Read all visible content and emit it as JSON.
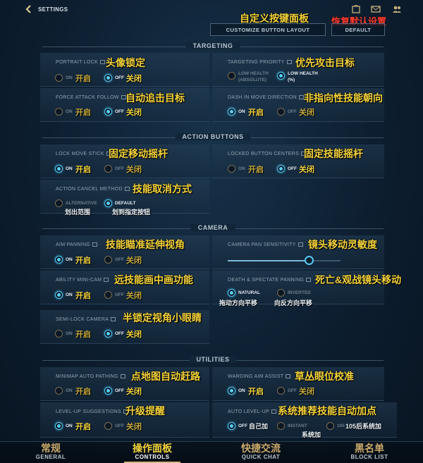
{
  "header": {
    "title": "SETTINGS",
    "annotation_custom_panel": "自定义按键面板",
    "annotation_restore_default": "恢复默认设置",
    "customize_button": "CUSTOMIZE BUTTON LAYOUT",
    "default_button": "DEFAULT",
    "icons": [
      "back-chevron-icon",
      "shop-icon",
      "mail-icon",
      "friends-icon"
    ]
  },
  "sections": {
    "targeting": "TARGETING",
    "action_buttons": "ACTION BUTTONS",
    "camera": "CAMERA",
    "utilities": "UTILITIES"
  },
  "common": {
    "on": "ON",
    "off": "OFF",
    "on_cn": "开启",
    "off_cn": "关闭"
  },
  "settings": {
    "portrait_lock": {
      "title": "PORTRAIT LOCK",
      "cn": "头像锁定"
    },
    "targeting_priority": {
      "title": "TARGETING PRIORITY",
      "cn": "优先攻击目标",
      "opt1": "LOW HEALTH",
      "opt1b": "(ABSOLUTE)",
      "opt2": "LOW HEALTH",
      "opt2b": "(%)"
    },
    "force_attack": {
      "title": "FORCE ATTACK FOLLOW",
      "cn": "自动追击目标"
    },
    "dash_direction": {
      "title": "DASH IN MOVE DIRECTION",
      "cn": "非指向性技能朝向"
    },
    "lock_move_stick": {
      "title": "LOCK MOVE STICK",
      "cn": "固定移动摇杆"
    },
    "locked_button_centers": {
      "title": "LOCKED BUTTON CENTERS",
      "cn": "固定技能摇杆"
    },
    "action_cancel": {
      "title": "ACTION CANCEL METHOD",
      "cn": "技能取消方式",
      "opt1": "ALTERNATIVE",
      "opt1_cn": "划出范围",
      "opt2": "DEFAULT",
      "opt2_cn": "划到指定按钮"
    },
    "aim_panning": {
      "title": "AIM PANNING",
      "cn": "技能瞄准延伸视角"
    },
    "camera_pan": {
      "title": "CAMERA PAN SENSITIVITY",
      "cn": "镜头移动灵敏度",
      "value": 0.72
    },
    "ability_minicam": {
      "title": "ABILITY MINI-CAM",
      "cn": "远技能画中画功能"
    },
    "death_spectate": {
      "title": "DEATH & SPECTATE PANNING",
      "cn": "死亡&观战镜头移动",
      "opt1": "NATURAL",
      "opt1_cn": "拖动方向平移",
      "opt2": "INVERTED",
      "opt2_cn": "向反方向平移"
    },
    "semi_lock": {
      "title": "SEMI-LOCK CAMERA",
      "cn": "半锁定视角小眼睛"
    },
    "minimap_pathing": {
      "title": "MINIMAP AUTO PATHING",
      "cn": "点地图自动赶路"
    },
    "warding_assist": {
      "title": "WARDING AIM ASSIST",
      "cn": "草丛眼位校准"
    },
    "levelup_suggestions": {
      "title": "LEVEL-UP SUGGESTIONS",
      "cn": "升级提醒"
    },
    "auto_levelup": {
      "title": "AUTO LEVEL-UP",
      "cn": "系统推荐技能自动加点",
      "opt1_cn": "自己加",
      "opt2": "INSTANT",
      "opt2_cn": "系统加",
      "opt3": "105",
      "opt3_cn": "105后系统加"
    }
  },
  "bottom_nav": [
    {
      "cn": "常规",
      "en": "GENERAL",
      "color": "#c9a86a"
    },
    {
      "cn": "操作面板",
      "en": "CONTROLS",
      "color": "#f3d23a"
    },
    {
      "cn": "快捷交流",
      "en": "QUICK CHAT",
      "color": "#c9a86a"
    },
    {
      "cn": "黑名单",
      "en": "BLOCK LIST",
      "color": "#c9a86a"
    }
  ]
}
